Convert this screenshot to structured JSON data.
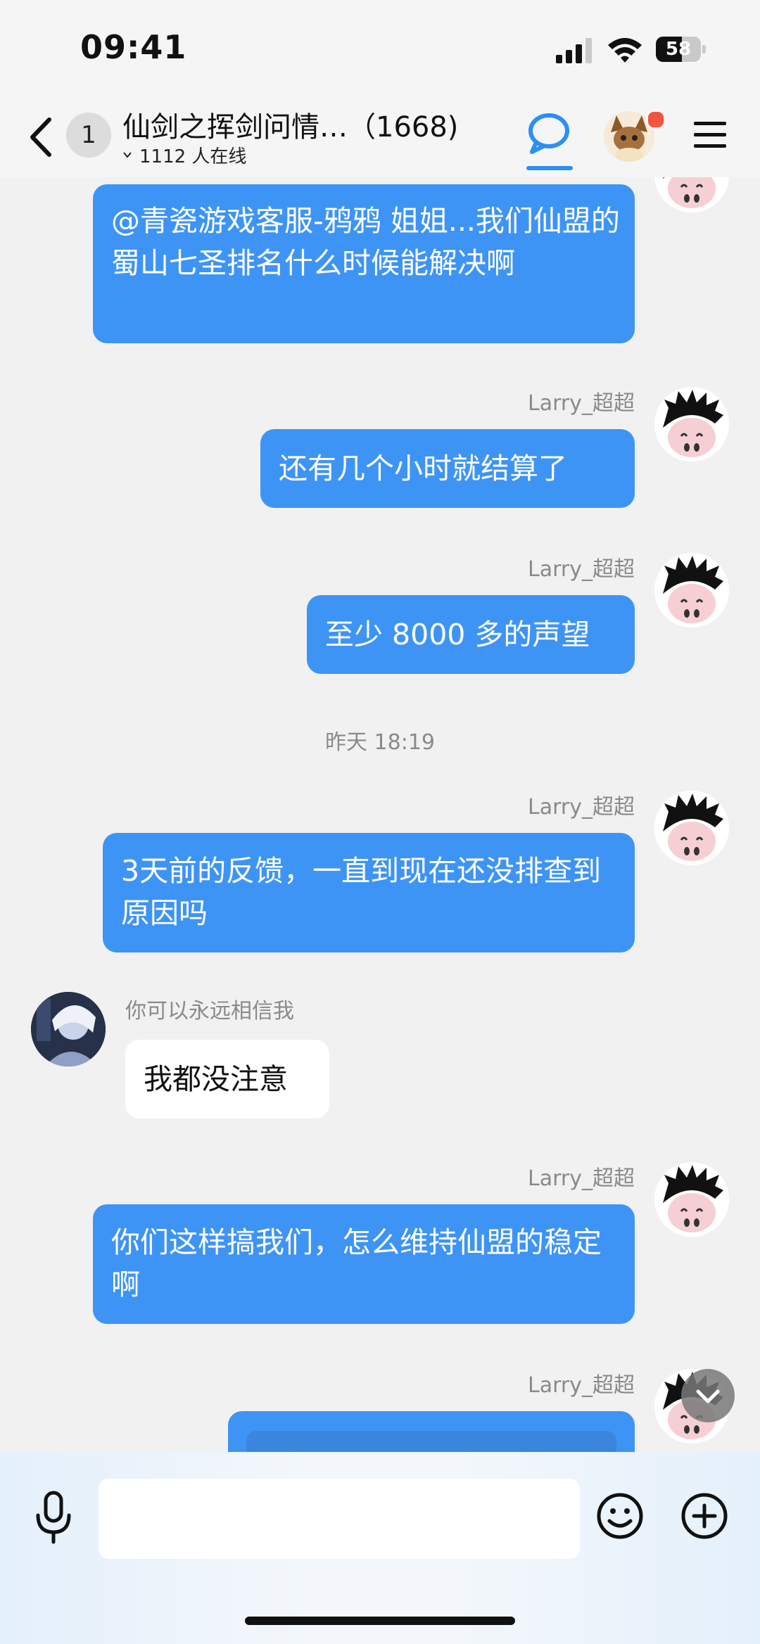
{
  "status_bar": {
    "time": "09:41",
    "battery": "58",
    "battery_level": 0.58
  },
  "header": {
    "unread_badge": "1",
    "title": "仙剑之挥剑问情…（1668)",
    "online_text": "1112 人在线"
  },
  "colors": {
    "accent": "#3e94f5",
    "background": "#f1f1f1",
    "notification": "#f2553f"
  },
  "messages": [
    {
      "text": "@青瓷游戏客服-鸦鸦 姐姐...我们仙盟的蜀山七圣排名什么时候能解决啊"
    },
    {
      "sender": "Larry_超超",
      "text": "还有几个小时就结算了"
    },
    {
      "sender": "Larry_超超",
      "text": "至少 8000 多的声望"
    },
    {
      "timestamp": "昨天 18:19"
    },
    {
      "sender": "Larry_超超",
      "text": "3天前的反馈，一直到现在还没排查到原因吗"
    },
    {
      "sender": "你可以永远相信我",
      "text": "我都没注意"
    },
    {
      "sender": "Larry_超超",
      "text": "你们这样搞我们，怎么维持仙盟的稳定啊"
    },
    {
      "sender": "Larry_超超"
    }
  ],
  "input": {
    "placeholder": ""
  },
  "icons": [
    "back-icon",
    "chat-bubble-icon",
    "menu-icon",
    "microphone-icon",
    "emoji-icon",
    "plus-icon",
    "chevron-down-icon"
  ]
}
